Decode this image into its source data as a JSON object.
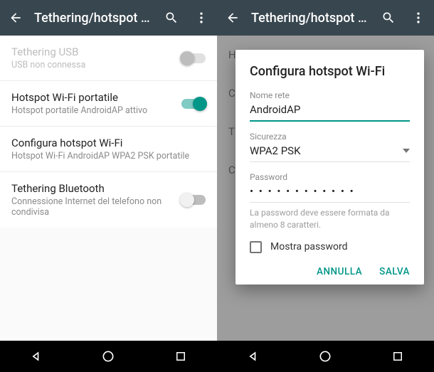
{
  "appbar": {
    "title_truncated": "Tethering/hotspot p..."
  },
  "list": {
    "usb": {
      "title": "Tethering USB",
      "subtitle": "USB non connessa"
    },
    "wifi": {
      "title": "Hotspot Wi-Fi portatile",
      "subtitle": "Hotspot portatile AndroidAP attivo"
    },
    "config": {
      "title": "Configura hotspot Wi-Fi",
      "subtitle": "Hotspot Wi-Fi AndroidAP WPA2 PSK portatile"
    },
    "bt": {
      "title": "Tethering Bluetooth",
      "subtitle": "Connessione Internet del telefono non condivisa"
    }
  },
  "bg_items": {
    "h": "H",
    "c": "C",
    "t": "T",
    "c2": "C"
  },
  "dialog": {
    "title": "Configura hotspot Wi-Fi",
    "network_label": "Nome rete",
    "network_value": "AndroidAP",
    "security_label": "Sicurezza",
    "security_value": "WPA2 PSK",
    "password_label": "Password",
    "password_value": "• • • • • • • • • • • •",
    "helper": "La password deve essere formata da almeno 8 caratteri.",
    "show_password": "Mostra password",
    "cancel": "ANNULLA",
    "save": "SALVA"
  }
}
